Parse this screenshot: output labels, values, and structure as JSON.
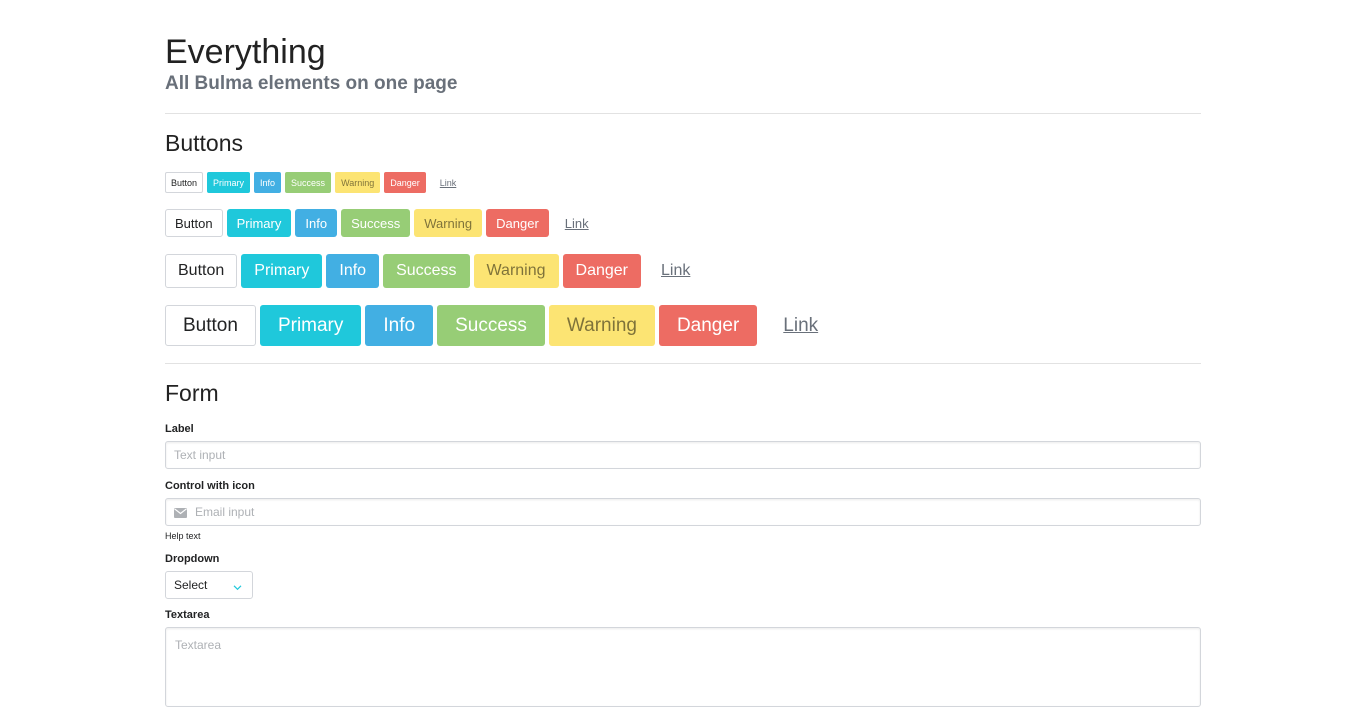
{
  "hero": {
    "title": "Everything",
    "subtitle": "All Bulma elements on one page"
  },
  "buttons_section": {
    "title": "Buttons",
    "labels": {
      "button": "Button",
      "primary": "Primary",
      "info": "Info",
      "success": "Success",
      "warning": "Warning",
      "danger": "Danger",
      "link": "Link"
    },
    "sizes": [
      "small",
      "normal",
      "medium",
      "large"
    ]
  },
  "form_section": {
    "title": "Form",
    "text_field": {
      "label": "Label",
      "placeholder": "Text input"
    },
    "email_field": {
      "label": "Control with icon",
      "placeholder": "Email input",
      "icon": "envelope-icon",
      "help": "Help text"
    },
    "dropdown": {
      "label": "Dropdown",
      "value": "Select"
    },
    "textarea": {
      "label": "Textarea",
      "placeholder": "Textarea"
    }
  },
  "colors": {
    "primary": "#1fc8db",
    "info": "#42afe3",
    "success": "#97cd76",
    "warning": "#fce473",
    "danger": "#ed6c63"
  }
}
